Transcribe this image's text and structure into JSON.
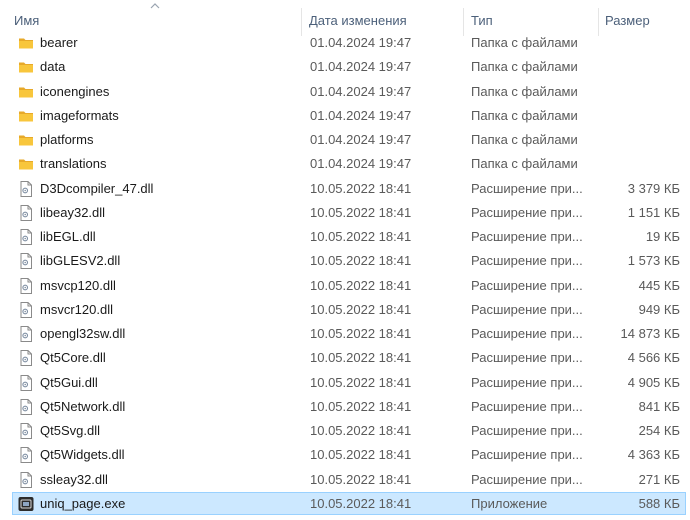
{
  "columns": {
    "name": "Имя",
    "date": "Дата изменения",
    "type": "Тип",
    "size": "Размер"
  },
  "files": [
    {
      "name": "bearer",
      "date": "01.04.2024 19:47",
      "type": "Папка с файлами",
      "size": "",
      "icon": "folder-icon"
    },
    {
      "name": "data",
      "date": "01.04.2024 19:47",
      "type": "Папка с файлами",
      "size": "",
      "icon": "folder-icon"
    },
    {
      "name": "iconengines",
      "date": "01.04.2024 19:47",
      "type": "Папка с файлами",
      "size": "",
      "icon": "folder-icon"
    },
    {
      "name": "imageformats",
      "date": "01.04.2024 19:47",
      "type": "Папка с файлами",
      "size": "",
      "icon": "folder-icon"
    },
    {
      "name": "platforms",
      "date": "01.04.2024 19:47",
      "type": "Папка с файлами",
      "size": "",
      "icon": "folder-icon"
    },
    {
      "name": "translations",
      "date": "01.04.2024 19:47",
      "type": "Папка с файлами",
      "size": "",
      "icon": "folder-icon"
    },
    {
      "name": "D3Dcompiler_47.dll",
      "date": "10.05.2022 18:41",
      "type": "Расширение при...",
      "size": "3 379 КБ",
      "icon": "dll-file-icon"
    },
    {
      "name": "libeay32.dll",
      "date": "10.05.2022 18:41",
      "type": "Расширение при...",
      "size": "1 151 КБ",
      "icon": "dll-file-icon"
    },
    {
      "name": "libEGL.dll",
      "date": "10.05.2022 18:41",
      "type": "Расширение при...",
      "size": "19 КБ",
      "icon": "dll-file-icon"
    },
    {
      "name": "libGLESV2.dll",
      "date": "10.05.2022 18:41",
      "type": "Расширение при...",
      "size": "1 573 КБ",
      "icon": "dll-file-icon"
    },
    {
      "name": "msvcp120.dll",
      "date": "10.05.2022 18:41",
      "type": "Расширение при...",
      "size": "445 КБ",
      "icon": "dll-file-icon"
    },
    {
      "name": "msvcr120.dll",
      "date": "10.05.2022 18:41",
      "type": "Расширение при...",
      "size": "949 КБ",
      "icon": "dll-file-icon"
    },
    {
      "name": "opengl32sw.dll",
      "date": "10.05.2022 18:41",
      "type": "Расширение при...",
      "size": "14 873 КБ",
      "icon": "dll-file-icon"
    },
    {
      "name": "Qt5Core.dll",
      "date": "10.05.2022 18:41",
      "type": "Расширение при...",
      "size": "4 566 КБ",
      "icon": "dll-file-icon"
    },
    {
      "name": "Qt5Gui.dll",
      "date": "10.05.2022 18:41",
      "type": "Расширение при...",
      "size": "4 905 КБ",
      "icon": "dll-file-icon"
    },
    {
      "name": "Qt5Network.dll",
      "date": "10.05.2022 18:41",
      "type": "Расширение при...",
      "size": "841 КБ",
      "icon": "dll-file-icon"
    },
    {
      "name": "Qt5Svg.dll",
      "date": "10.05.2022 18:41",
      "type": "Расширение при...",
      "size": "254 КБ",
      "icon": "dll-file-icon"
    },
    {
      "name": "Qt5Widgets.dll",
      "date": "10.05.2022 18:41",
      "type": "Расширение при...",
      "size": "4 363 КБ",
      "icon": "dll-file-icon"
    },
    {
      "name": "ssleay32.dll",
      "date": "10.05.2022 18:41",
      "type": "Расширение при...",
      "size": "271 КБ",
      "icon": "dll-file-icon"
    },
    {
      "name": "uniq_page.exe",
      "date": "10.05.2022 18:41",
      "type": "Приложение",
      "size": "588 КБ",
      "icon": "exe-app-icon",
      "selected": true
    }
  ],
  "colors": {
    "header_text": "#4c607a",
    "selection_bg": "#cce8ff",
    "selection_border": "#99d1ff",
    "folder": "#f8c63c"
  }
}
